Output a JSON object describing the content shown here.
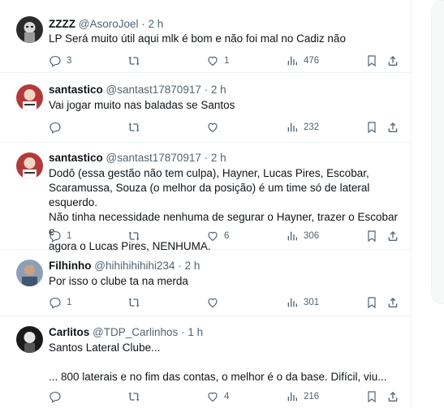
{
  "tweets": [
    {
      "name": "ZZZZ",
      "handle": "@AsoroJoel",
      "dot": "·",
      "time": "2 h",
      "text": "LP Será muito útil aqui mlk é bom e não foi mal no Cadiz não",
      "replies": "3",
      "retweets": "",
      "likes": "1",
      "views": "476"
    },
    {
      "name": "santastico",
      "handle": "@santast17870917",
      "dot": "·",
      "time": "2 h",
      "text": "Vai jogar muito nas baladas se Santos",
      "replies": "",
      "retweets": "",
      "likes": "",
      "views": "232"
    },
    {
      "name": "santastico",
      "handle": "@santast17870917",
      "dot": "·",
      "time": "2 h",
      "text": "Dodô (essa gestão não tem culpa), Hayner, Lucas Pires, Escobar,\nScaramussa, Souza (o melhor da posição) é um time só de lateral esquerdo.\nNão tinha necessidade nenhuma de segurar o Hayner, trazer o Escobar e\nagora o Lucas Pires, NENHUMA.",
      "replies": "1",
      "retweets": "",
      "likes": "6",
      "views": "306"
    },
    {
      "name": "Filhinho",
      "handle": "@hihihihihihi234",
      "dot": "·",
      "time": "2 h",
      "text": "Por isso o clube ta na merda",
      "replies": "1",
      "retweets": "",
      "likes": "",
      "views": "301"
    },
    {
      "name": "Carlitos",
      "handle": "@TDP_Carlinhos",
      "dot": "·",
      "time": "1 h",
      "text": "Santos Lateral Clube...\n\n... 800 laterais e no fim das contas, o melhor é o da base. Difícil, viu...",
      "replies": "",
      "retweets": "",
      "likes": "4",
      "views": "216"
    }
  ],
  "colors": {
    "text": "#0f1419",
    "secondary": "#536471",
    "divider": "#eff3f4",
    "link": "#1d9bf0"
  },
  "icons": [
    "reply-icon",
    "retweet-icon",
    "like-icon",
    "views-icon",
    "bookmark-icon",
    "share-icon"
  ]
}
